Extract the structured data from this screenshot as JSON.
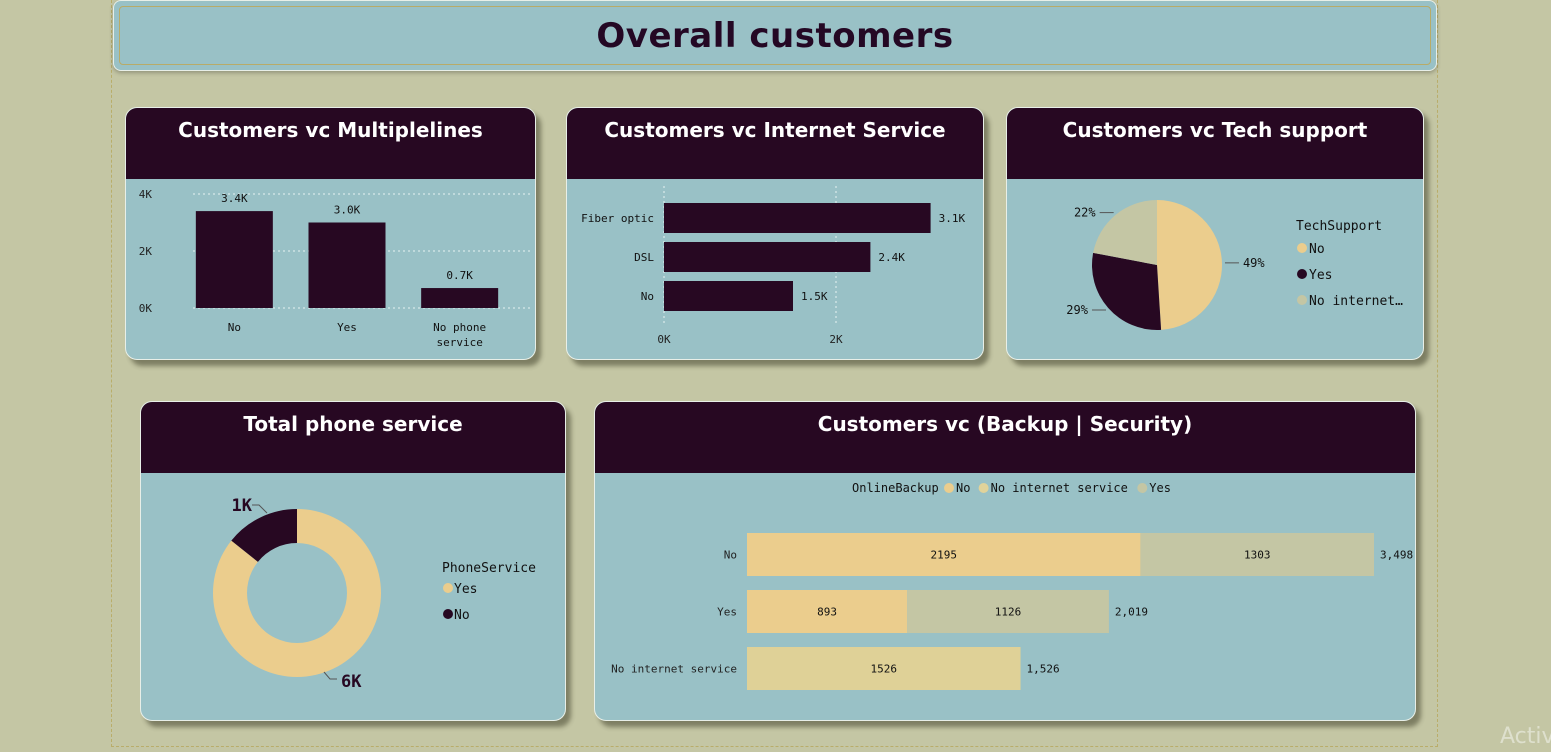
{
  "page_title": "Overall customers",
  "watermark": "Activ",
  "colors": {
    "dark": "#270822",
    "tan": "#ebcd8d",
    "grey": "#c4c6a4",
    "panel": "#99c1c6",
    "background": "#c4c6a4"
  },
  "chart_data": [
    {
      "id": "multiplelines",
      "type": "bar",
      "title": "Customers vc Multiplelines",
      "categories": [
        "No",
        "Yes",
        "No phone service"
      ],
      "category_lines": [
        [
          "No"
        ],
        [
          "Yes"
        ],
        [
          "No phone",
          "service"
        ]
      ],
      "values": [
        3.4,
        3.0,
        0.7
      ],
      "data_labels": [
        "3.4K",
        "3.0K",
        "0.7K"
      ],
      "yticks": [
        "0K",
        "2K",
        "4K"
      ],
      "ylim": [
        0,
        4
      ],
      "grid": true
    },
    {
      "id": "internet",
      "type": "bar",
      "orientation": "horizontal",
      "title": "Customers vc Internet Service",
      "categories": [
        "Fiber optic",
        "DSL",
        "No"
      ],
      "values": [
        3.1,
        2.4,
        1.5
      ],
      "data_labels": [
        "3.1K",
        "2.4K",
        "1.5K"
      ],
      "xticks": [
        "0K",
        "2K"
      ],
      "xlim": [
        0,
        3.5
      ],
      "grid": true
    },
    {
      "id": "techsupport",
      "type": "pie",
      "title": "Customers vc Tech support",
      "legend_title": "TechSupport",
      "labels": [
        "No",
        "Yes",
        "No internet…"
      ],
      "values": [
        49,
        29,
        22
      ],
      "data_labels": [
        "49%",
        "29%",
        "22%"
      ],
      "legend_position": "right"
    },
    {
      "id": "phoneservice",
      "type": "pie",
      "donut": true,
      "title": "Total phone service",
      "legend_title": "PhoneService",
      "labels": [
        "Yes",
        "No"
      ],
      "values": [
        6,
        1
      ],
      "data_labels": [
        "6K",
        "1K"
      ],
      "legend_position": "right"
    },
    {
      "id": "backup",
      "type": "bar",
      "orientation": "horizontal",
      "stacked": true,
      "title": "Customers vc (Backup | Security)",
      "legend_title": "OnlineBackup",
      "legend_position": "top",
      "categories": [
        "No",
        "Yes",
        "No internet service"
      ],
      "series": [
        {
          "name": "No",
          "values": [
            2195,
            893,
            0
          ]
        },
        {
          "name": "No internet service",
          "values": [
            0,
            0,
            1526
          ]
        },
        {
          "name": "Yes",
          "values": [
            1303,
            1126,
            0
          ]
        }
      ],
      "totals": [
        "3,498",
        "2,019",
        "1,526"
      ],
      "xlim": [
        0,
        3498
      ]
    }
  ]
}
